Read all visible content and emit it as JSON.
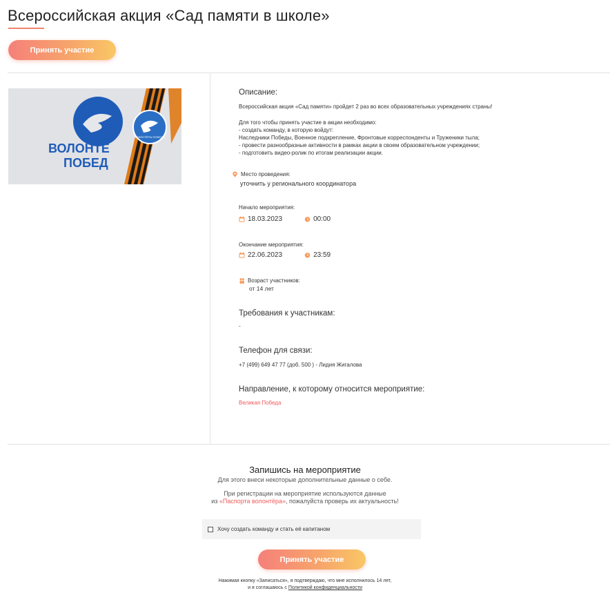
{
  "header": {
    "title": "Всероссийская акция «Сад памяти в школе»",
    "participate_label": "Принять участие"
  },
  "image": {
    "badge_text": "ВОЛОНТЁРЫ ПОБЕДЫ",
    "shirt_text_line1": "ВОЛОНТЁ",
    "shirt_text_line2": "ПОБЕД"
  },
  "description": {
    "heading": "Описание:",
    "lines": [
      "Всероссийская акция «Сад памяти» пройдет 2 раз во всех образовательных учреждениях страны!",
      "",
      "Для того чтобы принять участие в акции необходимо:",
      "- создать команду, в которую войдут:",
      "Наследники Победы, Военное подкрепление, Фронтовые корреспонденты и Труженики тыла;",
      "- провести разнообразные активности в рамках акции в своем образовательном учреждении;",
      "- подготовить видео-ролик по итогам реализации акции."
    ]
  },
  "location": {
    "label": "Место проведения:",
    "value": "уточнить у регионального координатора"
  },
  "start": {
    "label": "Начало мероприятия:",
    "date": "18.03.2023",
    "time": "00:00"
  },
  "end": {
    "label": "Окончание мероприятия:",
    "date": "22.06.2023",
    "time": "23:59"
  },
  "age": {
    "label": "Возраст участников:",
    "value": "от 14 лет"
  },
  "requirements": {
    "heading": "Требования к участникам:",
    "value": "-"
  },
  "phone": {
    "heading": "Телефон для связи:",
    "value": "+7 (499) 649 47 77 (доб. 500 ) - Лидия Жигалова"
  },
  "direction": {
    "heading": "Направление, к которому относится мероприятие:",
    "value": "Великая Победа"
  },
  "signup": {
    "title": "Запишись на мероприятие",
    "subtitle": "Для этого внеси некоторые дополнительные данные о себе.",
    "note_line1": "При регистрации на мероприятие используются данные",
    "note_line2_prefix": "из ",
    "note_line2_link": "«Паспорта волонтёра»",
    "note_line2_suffix": ", пожалуйста проверь их актуальность!",
    "checkbox_label": "Хочу создать команду и стать её капитаном",
    "button_label": "Принять участие",
    "footer_line1": "Нажимая кнопку «Записаться», я подтверждаю, что мне исполнилось 14 лет,",
    "footer_line2_prefix": "и я соглашаюсь с ",
    "footer_line2_link": "Политикой конфиденциальности"
  },
  "colors": {
    "accent": "#f0846a",
    "link_red": "#ee5a5a",
    "icon_orange": "#f59a5c",
    "shirt_blue": "#1f5cb8"
  }
}
